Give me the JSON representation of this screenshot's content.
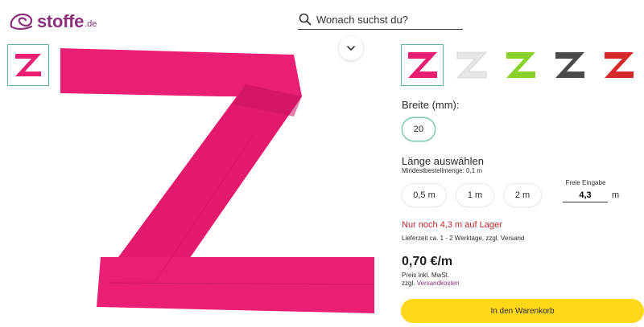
{
  "header": {
    "logo_text": "stoffe",
    "logo_tld": ".de",
    "search_placeholder": "Wonach suchst du?"
  },
  "colors": {
    "brand": "#8a2f7a",
    "accent": "#5fb4a2",
    "stock_warning": "#c0282f",
    "cart_button": "#ffd81a",
    "product_pink": "#ea1e73"
  },
  "swatches": [
    {
      "name": "pink",
      "color": "#e91e73",
      "selected": true
    },
    {
      "name": "white",
      "color": "#eaeaea",
      "selected": false
    },
    {
      "name": "lime",
      "color": "#8bd12c",
      "selected": false
    },
    {
      "name": "dark-grey",
      "color": "#4a4a4a",
      "selected": false
    },
    {
      "name": "red",
      "color": "#d7282c",
      "selected": false
    }
  ],
  "width": {
    "label": "Breite (mm):",
    "options": [
      "20"
    ]
  },
  "length": {
    "label": "Länge auswählen",
    "min_order": "Mindestbestellmenge: 0,1 m",
    "options": [
      "0,5 m",
      "1 m",
      "2 m"
    ],
    "free_input_label": "Freie Eingabe",
    "free_input_value": "4,3",
    "unit": "m"
  },
  "stock": "Nur noch 4,3 m auf Lager",
  "delivery": "Lieferzeit ca. 1 - 2 Werktage, zzgl. Versand",
  "price": "0,70 €/m",
  "vat": "Preis inkl. MwSt.",
  "shipping_prefix": "zzgl.",
  "shipping_link": "Versandkosten",
  "cart_button": "In den Warenkorb"
}
